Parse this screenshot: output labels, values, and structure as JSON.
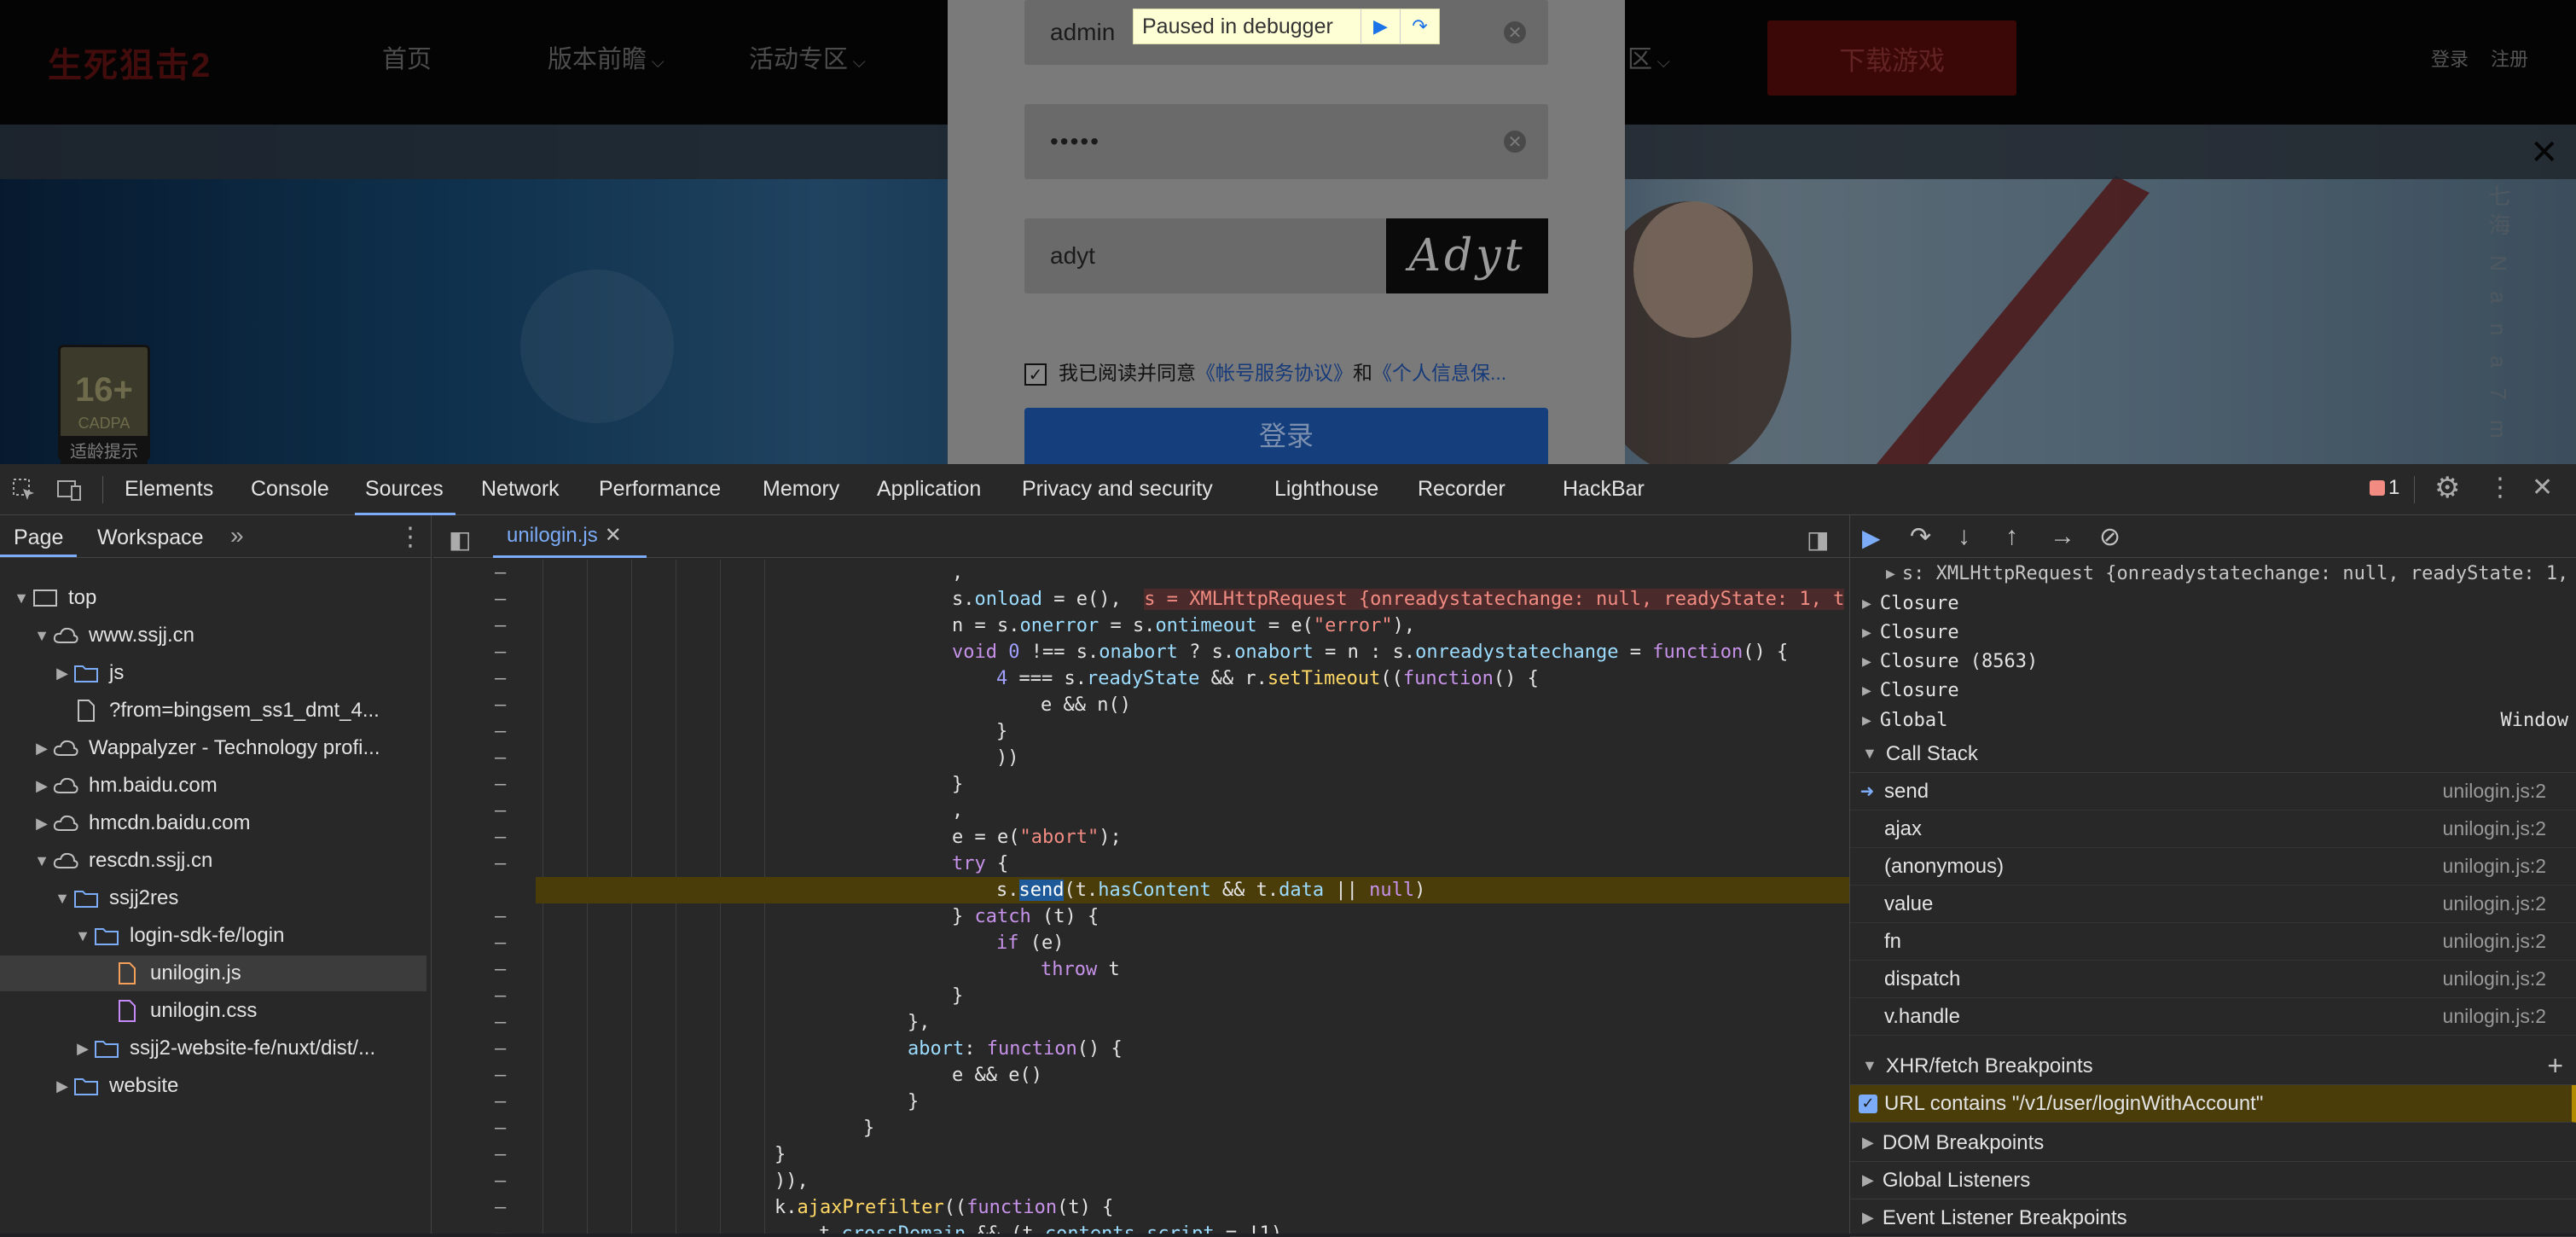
{
  "site": {
    "logo_text": "生死狙击2",
    "nav": [
      "首页",
      "版本前瞻",
      "活动专区"
    ],
    "nav_partial": "区",
    "download": "下载游戏",
    "login": "登录",
    "register": "注册",
    "age_rating": "16+",
    "age_sub": "CADPA",
    "age_label": "适龄提示",
    "side_text": "七海 N a n a 7 m"
  },
  "login_form": {
    "username": "admin",
    "password": "•••••",
    "captcha_input": "adyt",
    "captcha_image_text": "Adyt",
    "agree_text": "我已阅读并同意",
    "agree_link1": "《帐号服务协议》",
    "agree_and": "和",
    "agree_link2": "《个人信息保...",
    "submit": "登录",
    "paused_text": "Paused in debugger"
  },
  "devtools": {
    "tabs": [
      "Elements",
      "Console",
      "Sources",
      "Network",
      "Performance",
      "Memory",
      "Application",
      "Privacy and security",
      "Lighthouse",
      "Recorder",
      "HackBar"
    ],
    "active_tab": "Sources",
    "issues_count": "1",
    "nav_subtabs": [
      "Page",
      "Workspace"
    ],
    "file_tab": "unilogin.js",
    "tree": [
      {
        "label": "top",
        "depth": 0,
        "icon": "frame",
        "open": true
      },
      {
        "label": "www.ssjj.cn",
        "depth": 1,
        "icon": "cloud",
        "open": true
      },
      {
        "label": "js",
        "depth": 2,
        "icon": "folder",
        "open": false
      },
      {
        "label": "?from=bingsem_ss1_dmt_4...",
        "depth": 2,
        "icon": "file",
        "open": null
      },
      {
        "label": "Wappalyzer - Technology profi...",
        "depth": 1,
        "icon": "cloud",
        "open": false
      },
      {
        "label": "hm.baidu.com",
        "depth": 1,
        "icon": "cloud",
        "open": false
      },
      {
        "label": "hmcdn.baidu.com",
        "depth": 1,
        "icon": "cloud",
        "open": false
      },
      {
        "label": "rescdn.ssjj.cn",
        "depth": 1,
        "icon": "cloud",
        "open": true
      },
      {
        "label": "ssjj2res",
        "depth": 2,
        "icon": "folder",
        "open": true
      },
      {
        "label": "login-sdk-fe/login",
        "depth": 3,
        "icon": "folder",
        "open": true
      },
      {
        "label": "unilogin.js",
        "depth": 4,
        "icon": "js",
        "open": null,
        "selected": true
      },
      {
        "label": "unilogin.css",
        "depth": 4,
        "icon": "css",
        "open": null
      },
      {
        "label": "ssjj2-website-fe/nuxt/dist/...",
        "depth": 3,
        "icon": "folder",
        "open": false
      },
      {
        "label": "website",
        "depth": 2,
        "icon": "folder",
        "open": false
      }
    ],
    "scope": {
      "local_s": "s: XMLHttpRequest {onreadystatechange: null, readyState: 1,",
      "items": [
        "Closure",
        "Closure",
        "Closure (8563)",
        "Closure"
      ],
      "global": "Global",
      "global_value": "Window"
    },
    "call_stack_title": "Call Stack",
    "call_stack": [
      {
        "fn": "send",
        "loc": "unilogin.js:2",
        "current": true
      },
      {
        "fn": "ajax",
        "loc": "unilogin.js:2"
      },
      {
        "fn": "(anonymous)",
        "loc": "unilogin.js:2"
      },
      {
        "fn": "value",
        "loc": "unilogin.js:2"
      },
      {
        "fn": "fn",
        "loc": "unilogin.js:2"
      },
      {
        "fn": "dispatch",
        "loc": "unilogin.js:2"
      },
      {
        "fn": "v.handle",
        "loc": "unilogin.js:2"
      }
    ],
    "xhr_title": "XHR/fetch Breakpoints",
    "xhr_breakpoint": "URL contains \"/v1/user/loginWithAccount\"",
    "dom_bp": "DOM Breakpoints",
    "global_listeners": "Global Listeners",
    "event_bp": "Event Listener Breakpoints",
    "inline_value": "s = XMLHttpRequest {onreadystatechange: null, readyState: 1, t"
  }
}
